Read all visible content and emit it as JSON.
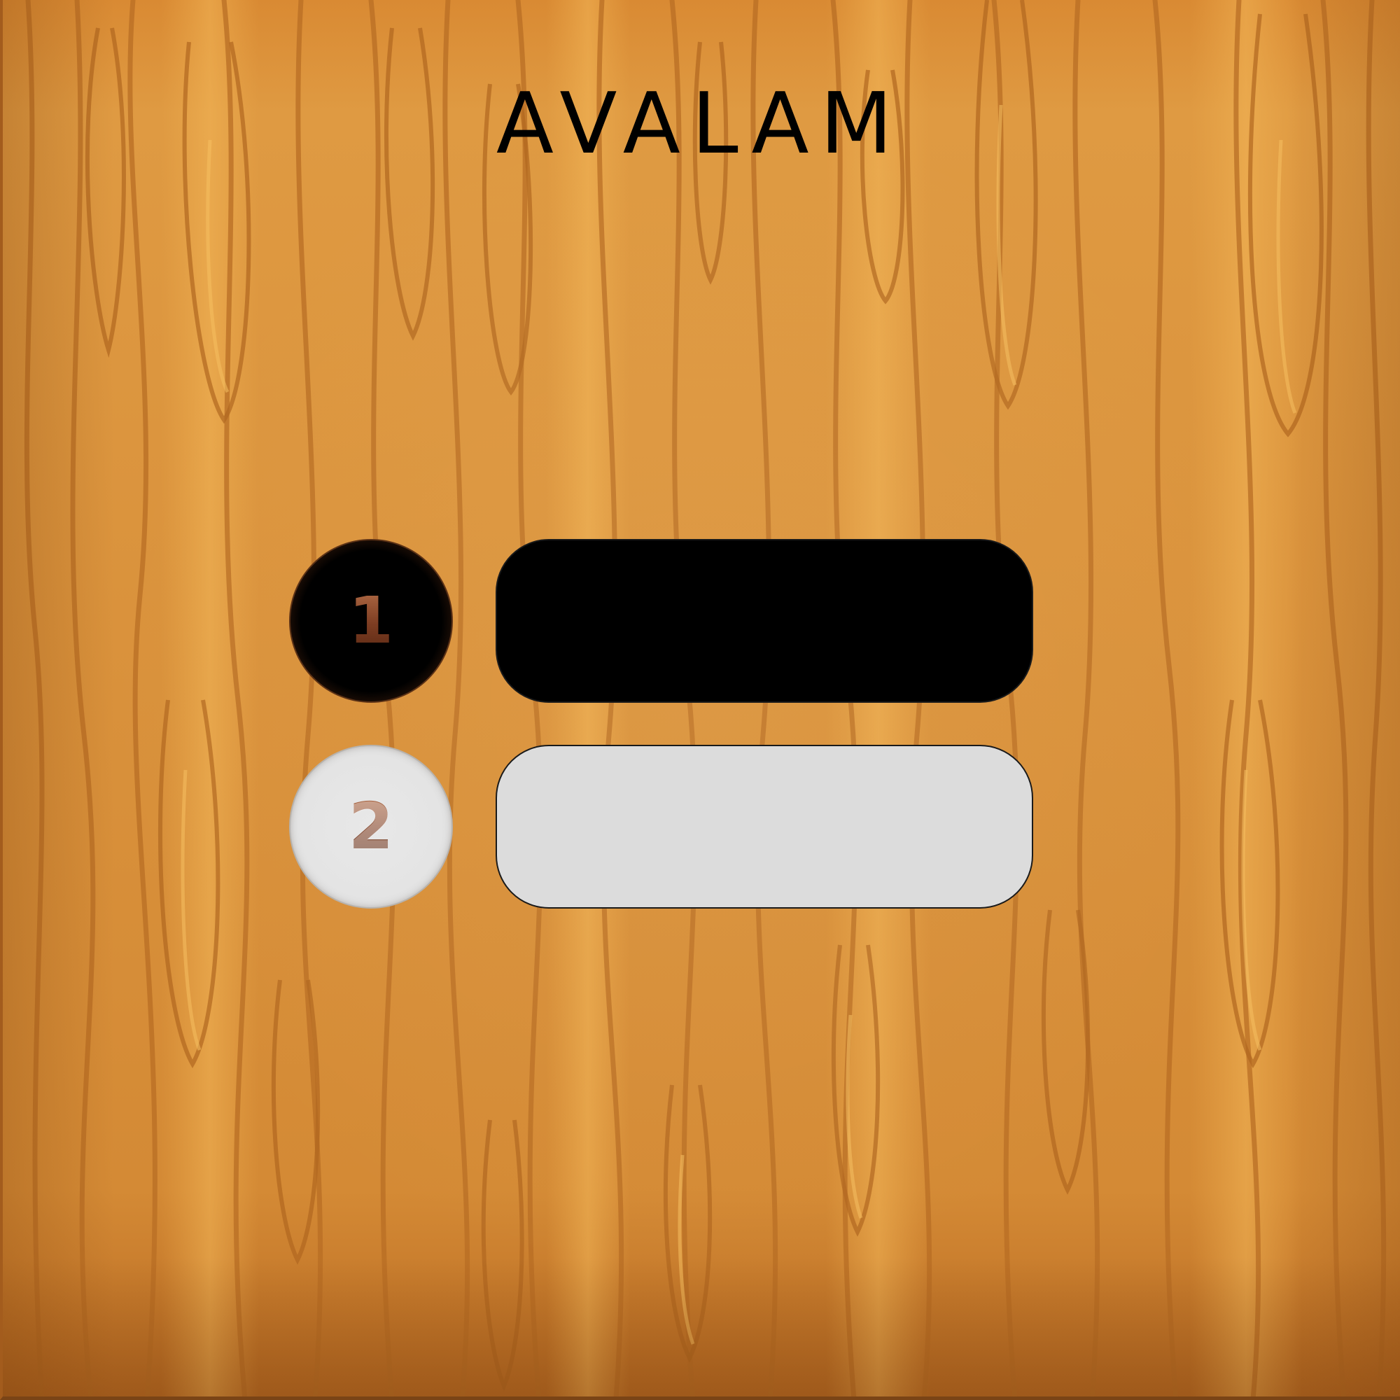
{
  "title": "AVALAM",
  "players": [
    {
      "number": "1",
      "color": "#000000",
      "name_value": "",
      "name_placeholder": ""
    },
    {
      "number": "2",
      "color": "#dcdcdc",
      "name_value": "",
      "name_placeholder": ""
    }
  ],
  "theme": {
    "background": "wood",
    "wood_color": "#d9913b",
    "number_color": "#8b4a2e"
  }
}
